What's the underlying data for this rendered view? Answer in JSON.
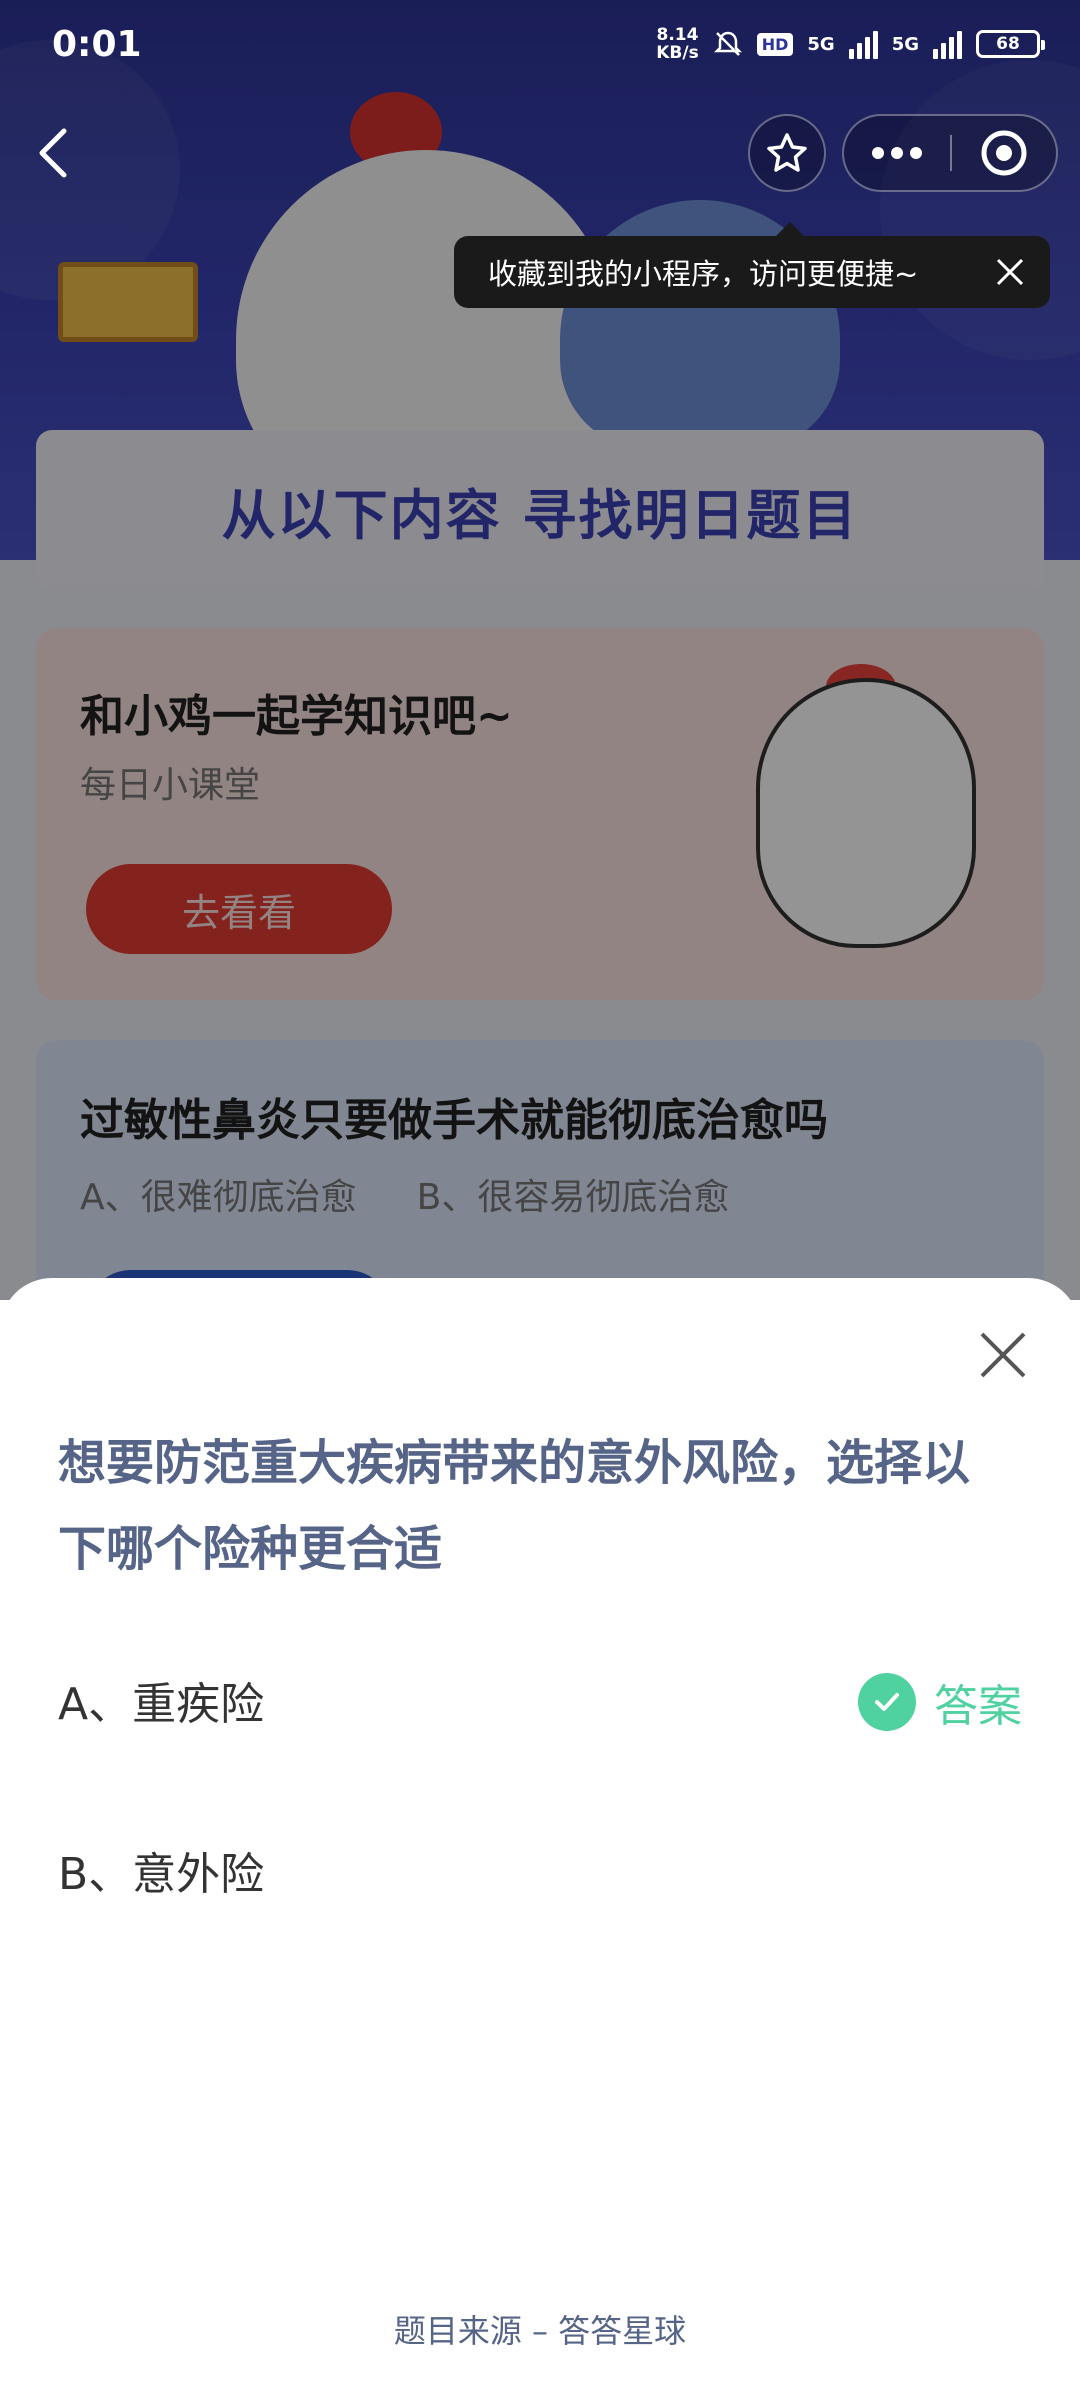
{
  "status_bar": {
    "time": "0:01",
    "net_speed_value": "8.14",
    "net_speed_unit": "KB/s",
    "hd_label": "HD",
    "net1": "5G",
    "net2": "5G",
    "battery": "68"
  },
  "tooltip": {
    "text": "收藏到我的小程序，访问更便捷~"
  },
  "background": {
    "title_card": "从以下内容  寻找明日题目",
    "lesson_card": {
      "title": "和小鸡一起学知识吧~",
      "subtitle": "每日小课堂",
      "button": "去看看"
    },
    "question_card": {
      "title": "过敏性鼻炎只要做手术就能彻底治愈吗",
      "option_a": "A、很难彻底治愈",
      "option_b": "B、很容易彻底治愈"
    }
  },
  "sheet": {
    "question": "想要防范重大疾病带来的意外风险，选择以下哪个险种更合适",
    "options": [
      {
        "label": "A、重疾险",
        "is_answer": true
      },
      {
        "label": "B、意外险",
        "is_answer": false
      }
    ],
    "answer_label": "答案",
    "footer": "题目来源 – 答答星球"
  },
  "colors": {
    "accent_green": "#4fd1a0",
    "question_text": "#556487",
    "hero_blue": "#3b43b5"
  },
  "icons": [
    "back-arrow-icon",
    "star-icon",
    "more-dots-icon",
    "target-icon",
    "close-icon",
    "check-icon",
    "bell-mute-icon",
    "signal-icon",
    "battery-icon"
  ]
}
